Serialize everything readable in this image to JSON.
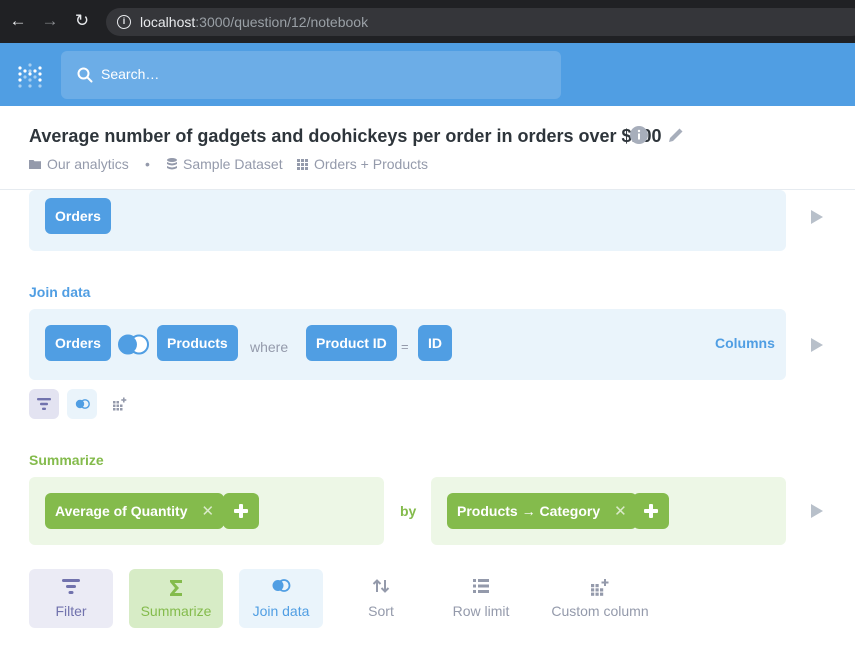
{
  "browser": {
    "url_host": "localhost",
    "url_rest": ":3000/question/12/notebook"
  },
  "header": {
    "search_placeholder": "Search…"
  },
  "question": {
    "title": "Average number of gadgets and doohickeys per order in orders over $100",
    "breadcrumbs": [
      "Our analytics",
      "Sample Dataset",
      "Orders + Products"
    ],
    "separator": "•"
  },
  "data_step": {
    "table": "Orders"
  },
  "join_step": {
    "label": "Join data",
    "left_table": "Orders",
    "right_table": "Products",
    "where_label": "where",
    "left_column": "Product ID",
    "operator": "=",
    "right_column": "ID",
    "columns_link": "Columns"
  },
  "summarize_step": {
    "label": "Summarize",
    "metric": "Average of Quantity",
    "by_label": "by",
    "dimension": "Products → Category"
  },
  "actions": [
    {
      "label": "Filter",
      "color": "#7172ad",
      "bg": "#ebebf5"
    },
    {
      "label": "Summarize",
      "color": "#84bb4c",
      "bg": "#d7ecc6"
    },
    {
      "label": "Join data",
      "color": "#509ee3",
      "bg": "#eaf4fb"
    },
    {
      "label": "Sort",
      "color": "#949aab",
      "bg": ""
    },
    {
      "label": "Row limit",
      "color": "#949aab",
      "bg": ""
    },
    {
      "label": "Custom column",
      "color": "#949aab",
      "bg": ""
    }
  ],
  "colors": {
    "brand": "#509ee3",
    "summarize": "#84bb4c",
    "filter": "#7172ad",
    "muted": "#949aab"
  }
}
